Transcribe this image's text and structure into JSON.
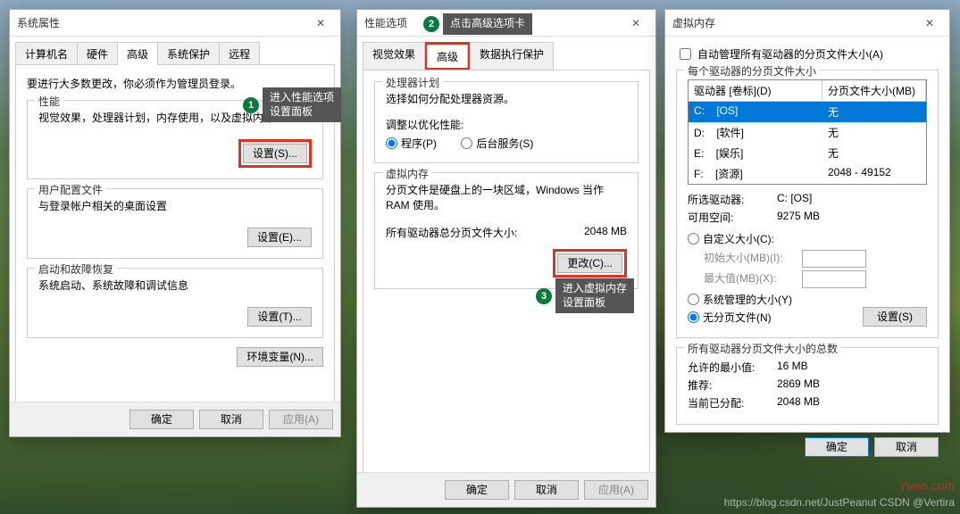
{
  "dialog1": {
    "title": "系统属性",
    "tabs": [
      "计算机名",
      "硬件",
      "高级",
      "系统保护",
      "远程"
    ],
    "intro": "要进行大多数更改，你必须作为管理员登录。",
    "perf": {
      "title": "性能",
      "desc": "视觉效果，处理器计划，内存使用，以及虚拟内存",
      "btn": "设置(S)..."
    },
    "user": {
      "title": "用户配置文件",
      "desc": "与登录帐户相关的桌面设置",
      "btn": "设置(E)..."
    },
    "boot": {
      "title": "启动和故障恢复",
      "desc": "系统启动、系统故障和调试信息",
      "btn": "设置(T)..."
    },
    "env_btn": "环境变量(N)...",
    "ok": "确定",
    "cancel": "取消",
    "apply": "应用(A)"
  },
  "dialog2": {
    "title": "性能选项",
    "tabs": [
      "视觉效果",
      "高级",
      "数据执行保护"
    ],
    "sched": {
      "title": "处理器计划",
      "desc": "选择如何分配处理器资源。",
      "opt_label": "调整以优化性能:",
      "opt1": "程序(P)",
      "opt2": "后台服务(S)"
    },
    "vm": {
      "title": "虚拟内存",
      "desc": "分页文件是硬盘上的一块区域，Windows 当作 RAM 使用。",
      "total_label": "所有驱动器总分页文件大小:",
      "total_value": "2048 MB",
      "btn": "更改(C)..."
    },
    "ok": "确定",
    "cancel": "取消",
    "apply": "应用(A)"
  },
  "dialog3": {
    "title": "虚拟内存",
    "auto": "自动管理所有驱动器的分页文件大小(A)",
    "each": "每个驱动器的分页文件大小",
    "col1": "驱动器 [卷标](D)",
    "col2": "分页文件大小(MB)",
    "drives": [
      {
        "d": "C:",
        "label": "[OS]",
        "p": "无"
      },
      {
        "d": "D:",
        "label": "[软件]",
        "p": "无"
      },
      {
        "d": "E:",
        "label": "[娱乐]",
        "p": "无"
      },
      {
        "d": "F:",
        "label": "[资源]",
        "p": "2048 - 49152"
      }
    ],
    "sel_drive_label": "所选驱动器:",
    "sel_drive": "C:  [OS]",
    "avail_label": "可用空间:",
    "avail": "9275 MB",
    "custom": "自定义大小(C):",
    "init_label": "初始大小(MB)(I):",
    "max_label": "最大值(MB)(X):",
    "sys_managed": "系统管理的大小(Y)",
    "no_page": "无分页文件(N)",
    "set_btn": "设置(S)",
    "totals_title": "所有驱动器分页文件大小的总数",
    "min_label": "允许的最小值:",
    "min": "16 MB",
    "rec_label": "推荐:",
    "rec": "2869 MB",
    "cur_label": "当前已分配:",
    "cur": "2048 MB",
    "ok": "确定",
    "cancel": "取消"
  },
  "anno": {
    "a1": "进入性能选项\n设置面板",
    "a2": "点击高级选项卡",
    "a3": "进入虚拟内存\n设置面板"
  },
  "wm1": "Yuen.com",
  "wm2": "https://blog.csdn.net/JustPeanut    CSDN @Vertira"
}
